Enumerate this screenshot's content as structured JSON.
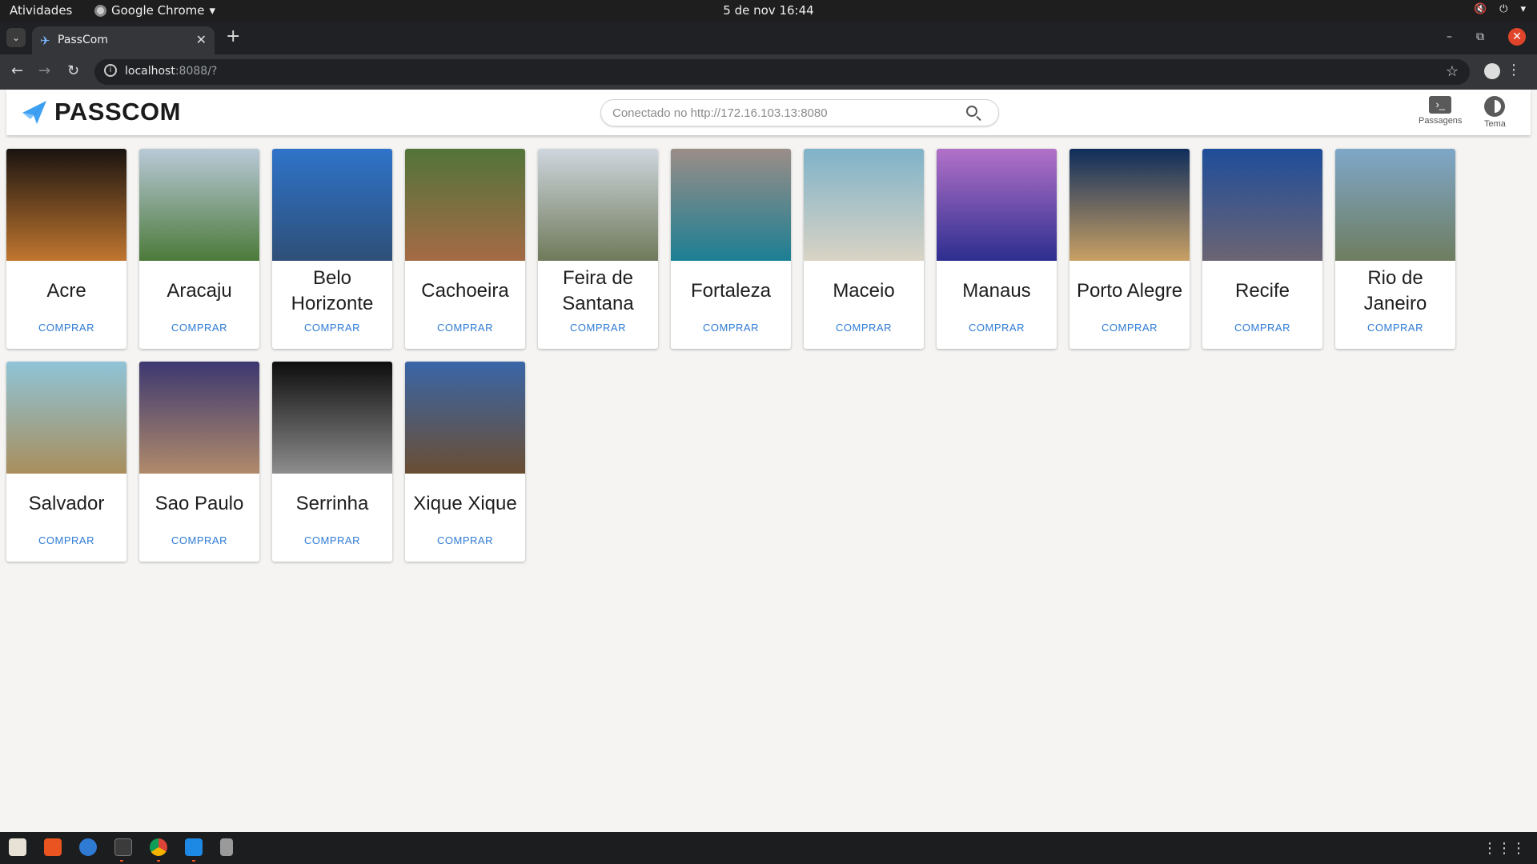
{
  "system": {
    "activities": "Atividades",
    "app_menu": "Google Chrome",
    "clock": "5 de nov  16:44"
  },
  "browser": {
    "tab_title": "PassCom",
    "url_host": "localhost",
    "url_path": ":8088/?"
  },
  "header": {
    "brand": "PASSCOM",
    "search_placeholder": "Conectado no http://172.16.103.13:8080",
    "tickets_label": "Passagens",
    "theme_label": "Tema"
  },
  "cards": [
    {
      "city": "Acre",
      "action": "COMPRAR",
      "colors": [
        "#1a1410",
        "#c0762f"
      ]
    },
    {
      "city": "Aracaju",
      "action": "COMPRAR",
      "colors": [
        "#b9c9d8",
        "#4c7a3a"
      ]
    },
    {
      "city": "Belo Horizonte",
      "action": "COMPRAR",
      "colors": [
        "#2f73c9",
        "#2e4f78"
      ]
    },
    {
      "city": "Cachoeira",
      "action": "COMPRAR",
      "colors": [
        "#52743a",
        "#a56a46"
      ]
    },
    {
      "city": "Feira de Santana",
      "action": "COMPRAR",
      "colors": [
        "#cfd6de",
        "#6f7a5a"
      ]
    },
    {
      "city": "Fortaleza",
      "action": "COMPRAR",
      "colors": [
        "#9b8d87",
        "#1c7f94"
      ]
    },
    {
      "city": "Maceio",
      "action": "COMPRAR",
      "colors": [
        "#7fb2c9",
        "#d9d3c4"
      ]
    },
    {
      "city": "Manaus",
      "action": "COMPRAR",
      "colors": [
        "#b271c9",
        "#2d2e8f"
      ]
    },
    {
      "city": "Porto Alegre",
      "action": "COMPRAR",
      "colors": [
        "#0f2d5c",
        "#c9a064"
      ]
    },
    {
      "city": "Recife",
      "action": "COMPRAR",
      "colors": [
        "#1f4d9a",
        "#6b6473"
      ]
    },
    {
      "city": "Rio de Janeiro",
      "action": "COMPRAR",
      "colors": [
        "#7fa7c9",
        "#6e7d5f"
      ]
    },
    {
      "city": "Salvador",
      "action": "COMPRAR",
      "colors": [
        "#8fc4d8",
        "#a88e5c"
      ]
    },
    {
      "city": "Sao Paulo",
      "action": "COMPRAR",
      "colors": [
        "#3c3870",
        "#b08a6a"
      ]
    },
    {
      "city": "Serrinha",
      "action": "COMPRAR",
      "colors": [
        "#0d0d0d",
        "#8d8d8d"
      ]
    },
    {
      "city": "Xique Xique",
      "action": "COMPRAR",
      "colors": [
        "#3a66a8",
        "#6a4e33"
      ]
    }
  ],
  "icons": {
    "logo": "paper-plane-icon",
    "search": "search-icon",
    "tickets": "ticket-icon",
    "theme": "theme-icon"
  }
}
